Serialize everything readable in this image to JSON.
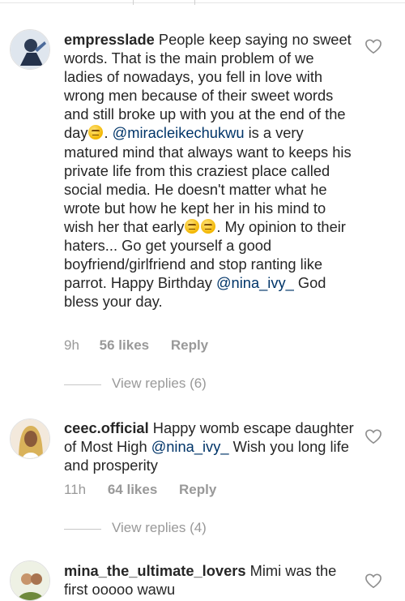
{
  "comments": [
    {
      "username": "empresslade",
      "text_parts": [
        "People keep saying no sweet words. That is the main problem of we ladies of nowadays, you fell in love with wrong men because of their sweet words and still broke up with you at the end of the day",
        ". ",
        "@miracleikechukwu",
        " is a very matured mind that always want to keeps his private life from this craziest place called social media. He doesn't matter what he wrote but how he kept her in his mind to wish her that early",
        ". My opinion to their haters... Go get yourself a good boyfriend/girlfriend  and stop ranting like parrot. Happy Birthday ",
        "@nina_ivy_",
        " God bless your day."
      ],
      "time": "9h",
      "likes": "56 likes",
      "reply": "Reply",
      "view_replies": "View replies (6)"
    },
    {
      "username": "ceec.official",
      "text_parts": [
        "Happy womb escape daughter of Most High ",
        "@nina_ivy_",
        " Wish you long life and prosperity"
      ],
      "time": "11h",
      "likes": "64 likes",
      "reply": "Reply",
      "view_replies": "View replies (4)"
    },
    {
      "username": "mina_the_ultimate_lovers",
      "text": "Mimi was the first ooooo wawu"
    }
  ],
  "icons": {
    "like": "heart-outline-icon",
    "emoji": "rolling-eyes-emoji"
  },
  "colors": {
    "text": "#262626",
    "mention": "#003569",
    "meta": "#999999"
  }
}
